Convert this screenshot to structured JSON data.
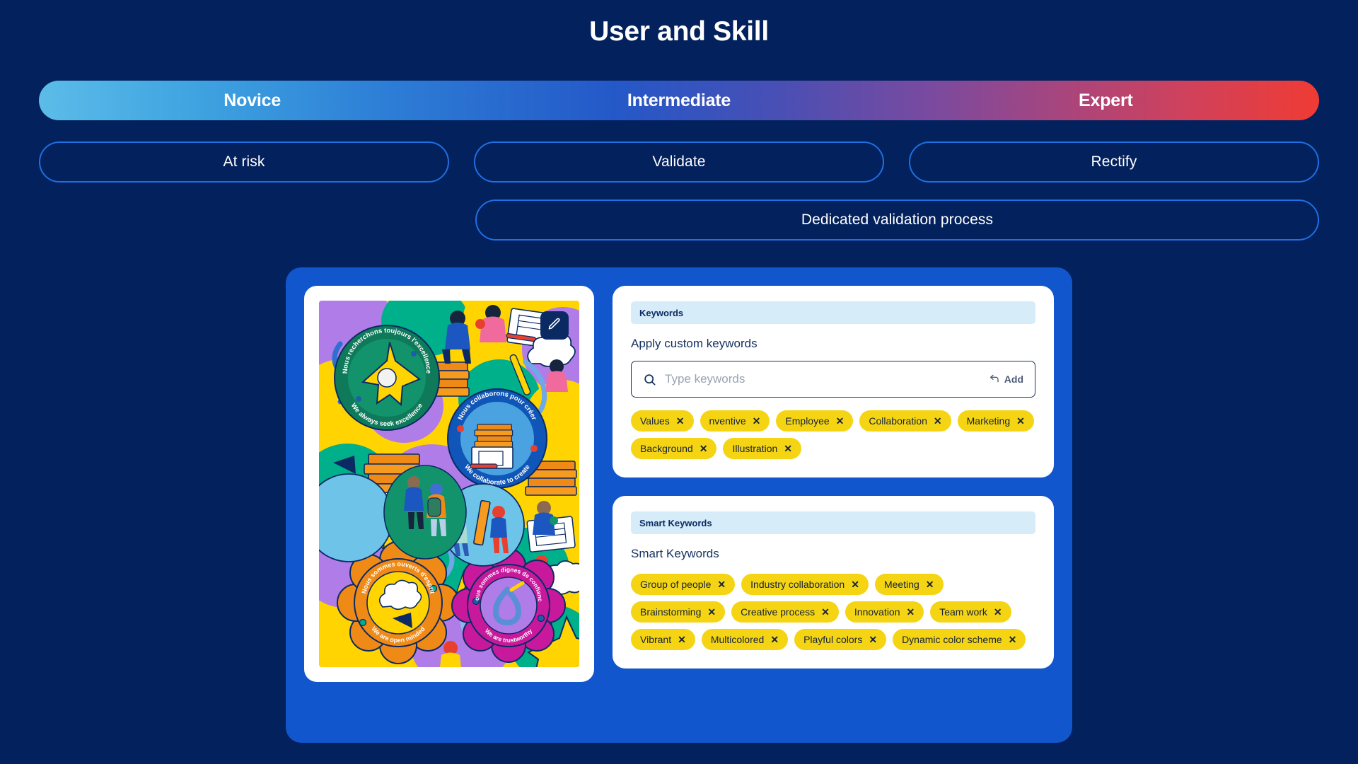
{
  "page": {
    "title": "User and Skill",
    "background_color": "#03215c",
    "accent_blue": "#1256cd",
    "tag_yellow": "#f5d513"
  },
  "skill_bar": {
    "gradient_from": "#5cbce9",
    "gradient_mid": "#2458c8",
    "gradient_to": "#ef3b34",
    "levels": [
      {
        "label": "Novice"
      },
      {
        "label": "Intermediate"
      },
      {
        "label": "Expert"
      }
    ]
  },
  "actions": {
    "row1": [
      {
        "label": "At risk"
      },
      {
        "label": "Validate"
      },
      {
        "label": "Rectify"
      }
    ],
    "row2": [
      {
        "label": "Dedicated validation process"
      }
    ]
  },
  "image_card": {
    "edit_icon": "pencil-icon",
    "alt": "Colorful illustration collage of company values badges"
  },
  "keywords_card": {
    "header": "Keywords",
    "sublabel": "Apply custom keywords",
    "search": {
      "icon": "search-icon",
      "placeholder": "Type keywords",
      "value": "",
      "add_icon": "enter-return-icon",
      "add_label": "Add"
    },
    "tags": [
      {
        "label": "Values"
      },
      {
        "label": "nventive"
      },
      {
        "label": "Employee"
      },
      {
        "label": "Collaboration"
      },
      {
        "label": "Marketing"
      },
      {
        "label": "Background"
      },
      {
        "label": "Illustration"
      }
    ]
  },
  "smart_keywords_card": {
    "header": "Smart Keywords",
    "sublabel": "Smart Keywords",
    "tags": [
      {
        "label": "Group of people"
      },
      {
        "label": "Industry collaboration"
      },
      {
        "label": "Meeting"
      },
      {
        "label": "Brainstorming"
      },
      {
        "label": "Creative process"
      },
      {
        "label": "Innovation"
      },
      {
        "label": "Team work"
      },
      {
        "label": "Vibrant"
      },
      {
        "label": "Multicolored"
      },
      {
        "label": "Playful colors"
      },
      {
        "label": "Dynamic color scheme"
      }
    ]
  }
}
